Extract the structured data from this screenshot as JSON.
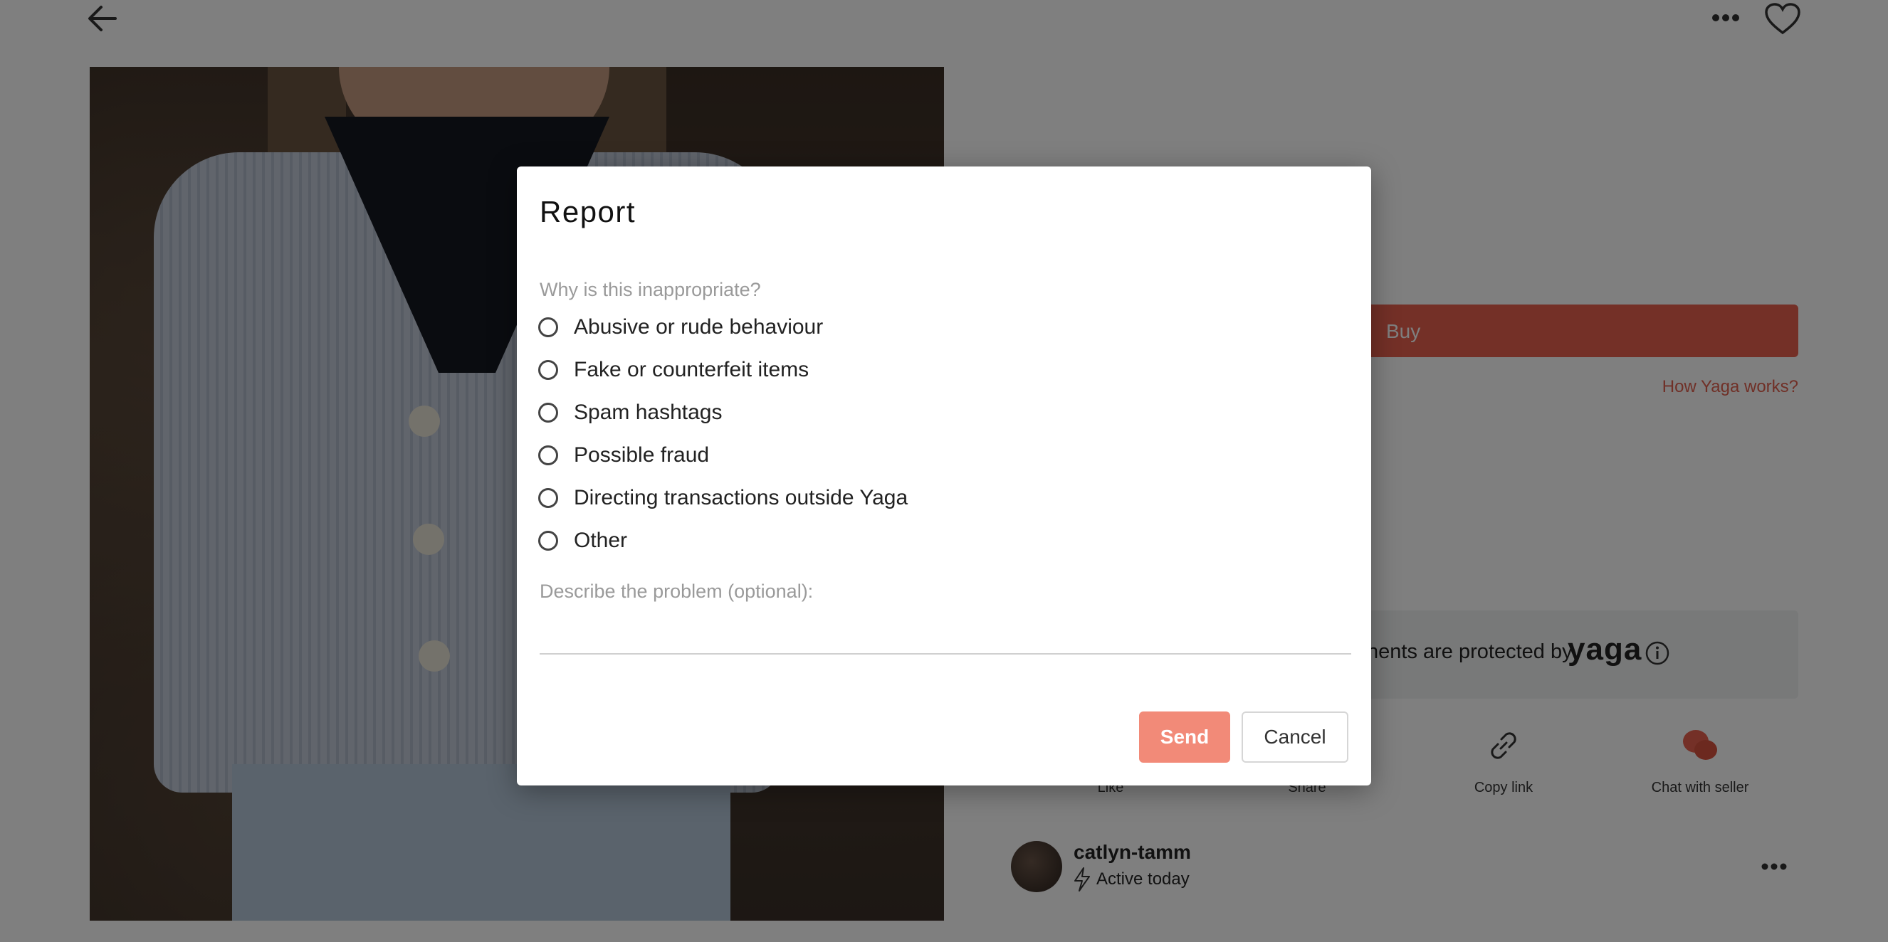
{
  "header": {
    "back_icon": "arrow-left-icon",
    "more_icon": "more-horizontal-icon",
    "like_icon": "heart-icon"
  },
  "product": {
    "buy_label": "Buy",
    "how_it_works": "How Yaga works?",
    "protection_text": "nents are protected by",
    "protection_brand": "yaga",
    "protection_icon": "info-icon"
  },
  "actions": [
    {
      "label": "Like",
      "icon": "heart-icon"
    },
    {
      "label": "Share",
      "icon": "share-icon"
    },
    {
      "label": "Copy link",
      "icon": "link-icon"
    },
    {
      "label": "Chat with seller",
      "icon": "chat-icon"
    }
  ],
  "seller": {
    "name": "catlyn-tamm",
    "status": "Active today",
    "status_icon": "bolt-icon"
  },
  "report_modal": {
    "title": "Report",
    "question": "Why is this inappropriate?",
    "options": [
      "Abusive or rude behaviour",
      "Fake or counterfeit items",
      "Spam hashtags",
      "Possible fraud",
      "Directing transactions outside Yaga",
      "Other"
    ],
    "describe_label": "Describe the problem (optional):",
    "describe_value": "",
    "send_label": "Send",
    "cancel_label": "Cancel"
  },
  "colors": {
    "accent": "#e8604f",
    "send_button": "#f28a78",
    "overlay": "rgba(0,0,0,0.5)"
  }
}
